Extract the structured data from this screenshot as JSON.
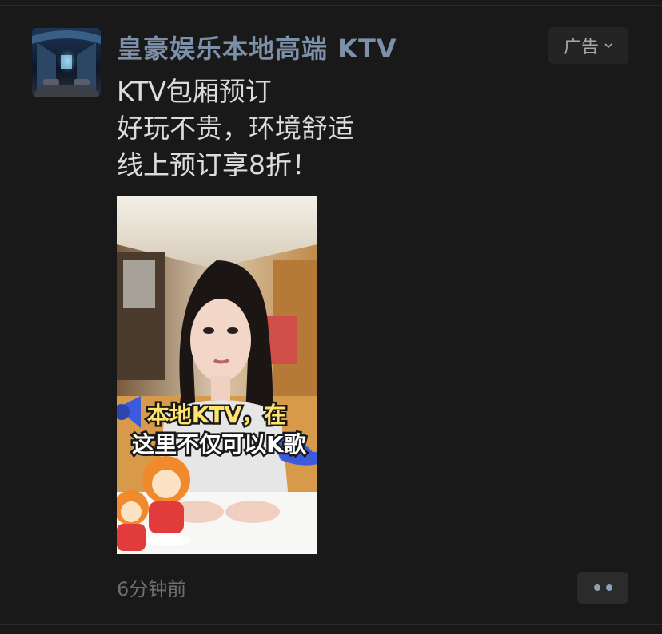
{
  "post": {
    "poster_name": "皇豪娱乐本地高端 KTV",
    "ad_label": "广告",
    "text_lines": [
      "KTV包厢预订",
      "好玩不贵，环境舒适",
      "线上预订享8折！"
    ],
    "media_caption_line1": "本地KTV，在",
    "media_caption_line2": "这里不仅可以K歌",
    "timestamp": "6分钟前"
  },
  "icons": {
    "ad_menu": "chevron-down-icon",
    "more": "more-dots-icon"
  },
  "colors": {
    "background": "#191919",
    "poster_name": "#7d90a9",
    "body_text": "#dcdcdc",
    "timestamp": "#6e6e6e",
    "button_bg": "#2b2b2b",
    "more_dots": "#8e9fb7"
  }
}
